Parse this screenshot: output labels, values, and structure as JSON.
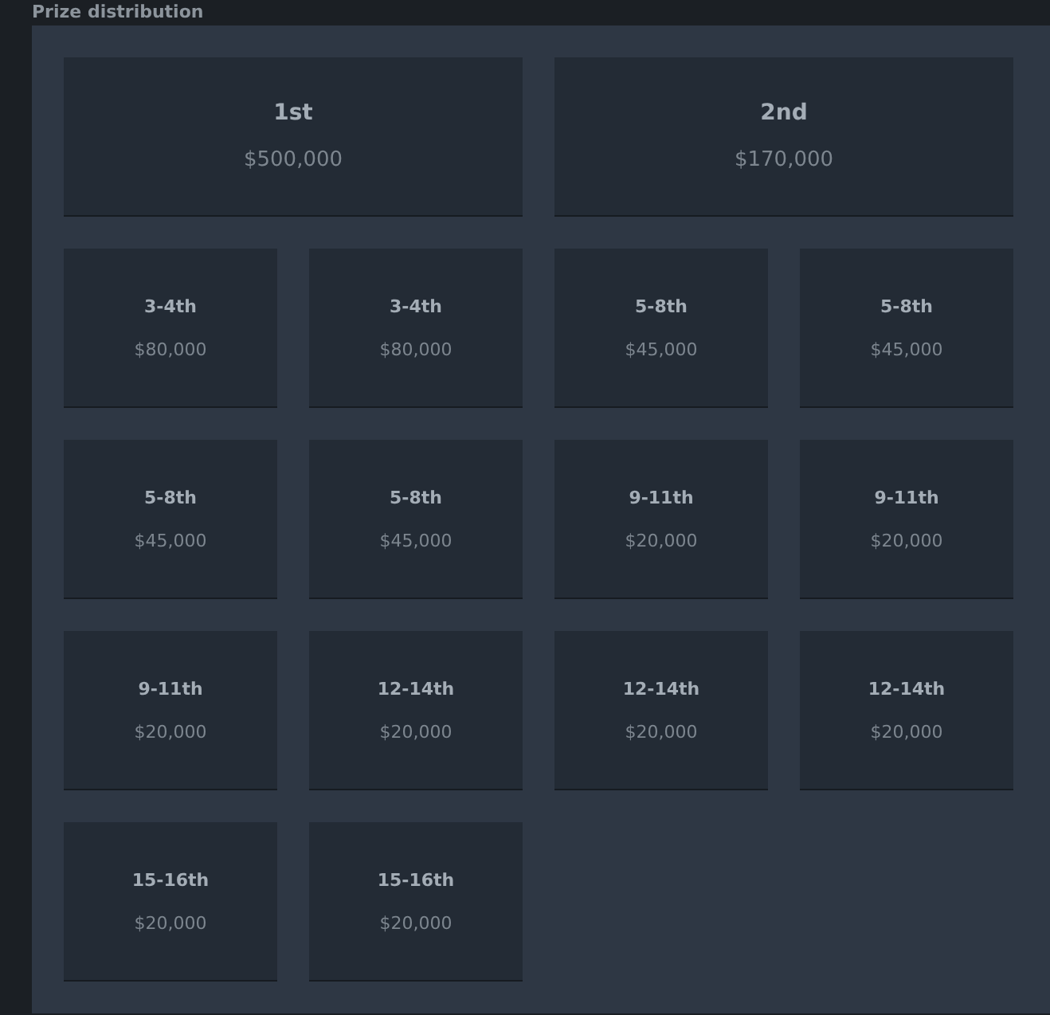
{
  "section": {
    "title": "Prize distribution"
  },
  "prizes": [
    {
      "kind": "major",
      "place": "1st",
      "amount": "$500,000"
    },
    {
      "kind": "major",
      "place": "2nd",
      "amount": "$170,000"
    },
    {
      "kind": "minor",
      "place": "3-4th",
      "amount": "$80,000"
    },
    {
      "kind": "minor",
      "place": "3-4th",
      "amount": "$80,000"
    },
    {
      "kind": "minor",
      "place": "5-8th",
      "amount": "$45,000"
    },
    {
      "kind": "minor",
      "place": "5-8th",
      "amount": "$45,000"
    },
    {
      "kind": "minor",
      "place": "5-8th",
      "amount": "$45,000"
    },
    {
      "kind": "minor",
      "place": "5-8th",
      "amount": "$45,000"
    },
    {
      "kind": "minor",
      "place": "9-11th",
      "amount": "$20,000"
    },
    {
      "kind": "minor",
      "place": "9-11th",
      "amount": "$20,000"
    },
    {
      "kind": "minor",
      "place": "9-11th",
      "amount": "$20,000"
    },
    {
      "kind": "minor",
      "place": "12-14th",
      "amount": "$20,000"
    },
    {
      "kind": "minor",
      "place": "12-14th",
      "amount": "$20,000"
    },
    {
      "kind": "minor",
      "place": "12-14th",
      "amount": "$20,000"
    },
    {
      "kind": "minor",
      "place": "15-16th",
      "amount": "$20,000"
    },
    {
      "kind": "minor",
      "place": "15-16th",
      "amount": "$20,000"
    }
  ]
}
